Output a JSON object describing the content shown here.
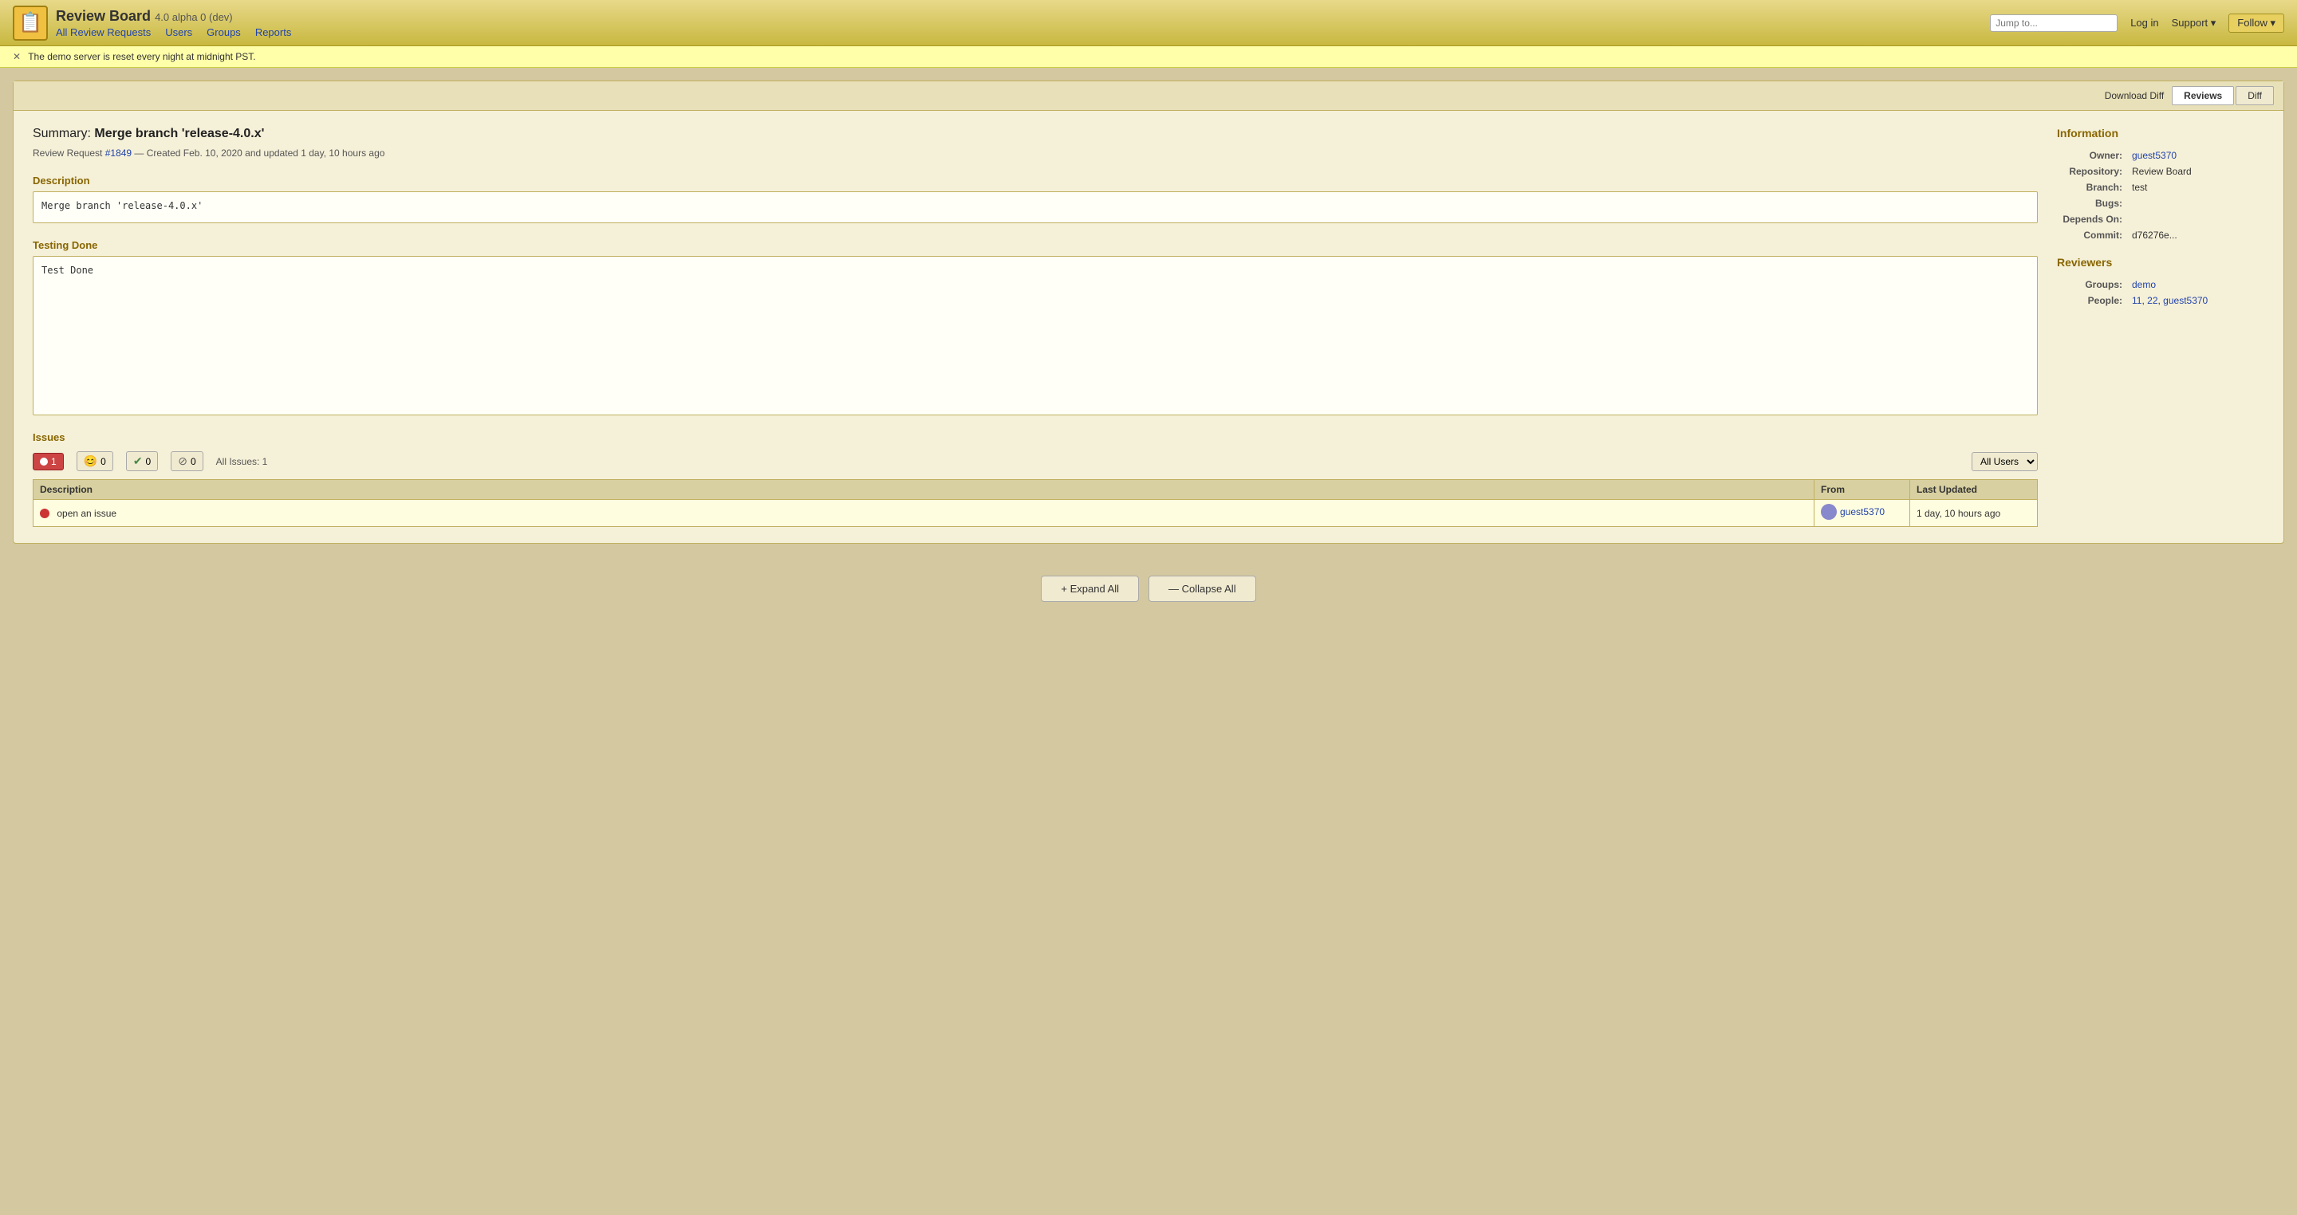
{
  "header": {
    "logo_emoji": "📋",
    "site_title": "Review Board",
    "site_version": "4.0 alpha 0 (dev)",
    "nav": {
      "all_review_requests": "All Review Requests",
      "users": "Users",
      "groups": "Groups",
      "reports": "Reports"
    },
    "jump_to_placeholder": "Jump to...",
    "login_label": "Log in",
    "support_label": "Support ▾",
    "follow_label": "Follow ▾"
  },
  "demo_banner": {
    "message": "The demo server is reset every night at midnight PST."
  },
  "toolbar": {
    "download_diff": "Download Diff",
    "reviews_tab": "Reviews",
    "diff_tab": "Diff"
  },
  "review_request": {
    "summary_label": "Summary:",
    "summary_value": "Merge branch 'release-4.0.x'",
    "meta": "Review Request #1849 — Created Feb. 10, 2020 and updated 1 day, 10 hours ago",
    "review_request_link_text": "#1849",
    "description_label": "Description",
    "description_value": "Merge branch 'release-4.0.x'",
    "testing_done_label": "Testing Done",
    "testing_done_value": "Test Done"
  },
  "information": {
    "section_title": "Information",
    "owner_label": "Owner:",
    "owner_value": "guest5370",
    "repository_label": "Repository:",
    "repository_value": "Review Board",
    "branch_label": "Branch:",
    "branch_value": "test",
    "bugs_label": "Bugs:",
    "bugs_value": "",
    "depends_on_label": "Depends On:",
    "depends_on_value": "",
    "commit_label": "Commit:",
    "commit_value": "d76276e..."
  },
  "reviewers": {
    "section_title": "Reviewers",
    "groups_label": "Groups:",
    "groups_value": "demo",
    "people_label": "People:",
    "people_values": [
      "11",
      "22",
      "guest5370"
    ]
  },
  "issues": {
    "section_title": "Issues",
    "filters": {
      "open_count": 1,
      "smiley_count": 0,
      "check_count": 0,
      "x_count": 0,
      "all_issues_label": "All Issues: 1"
    },
    "user_filter": "All Users",
    "table_headers": {
      "description": "Description",
      "from": "From",
      "last_updated": "Last Updated"
    },
    "rows": [
      {
        "description": "open an issue",
        "from_user": "guest5370",
        "last_updated": "1 day, 10 hours ago"
      }
    ]
  },
  "bottom_actions": {
    "expand_all": "+ Expand All",
    "collapse_all": "— Collapse All"
  }
}
